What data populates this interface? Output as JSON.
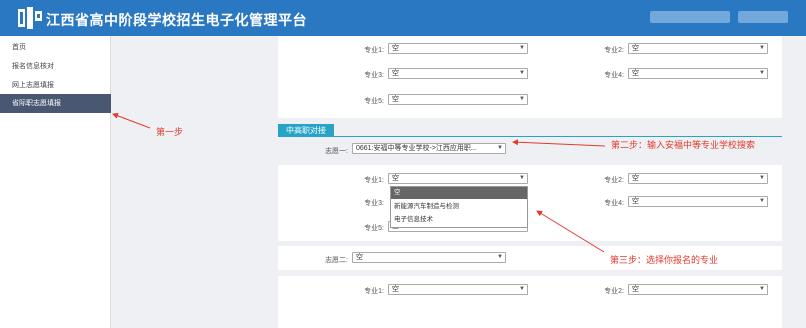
{
  "header": {
    "title": "江西省高中阶段学校招生电子化管理平台"
  },
  "sidebar": {
    "items": [
      {
        "label": "首页"
      },
      {
        "label": "报名信息核对"
      },
      {
        "label": "网上志愿填报"
      },
      {
        "label": "省际职志愿填报"
      }
    ]
  },
  "block1": {
    "rows": [
      {
        "label": "专业1:",
        "value": "空"
      },
      {
        "label": "专业2:",
        "value": "空"
      },
      {
        "label": "专业3:",
        "value": "空"
      },
      {
        "label": "专业4:",
        "value": "空"
      },
      {
        "label": "专业5:",
        "value": "空"
      }
    ]
  },
  "section": {
    "tag": "中高职对接"
  },
  "choice1": {
    "label": "志愿一:",
    "value": "0661:安福中等专业学校->江西应用职..."
  },
  "block2": {
    "rows": [
      {
        "label": "专业1:",
        "value": "空"
      },
      {
        "label": "专业2:",
        "value": "空"
      },
      {
        "label": "专业3:",
        "value": ""
      },
      {
        "label": "专业4:",
        "value": "空"
      },
      {
        "label": "专业5:",
        "value": "空"
      }
    ],
    "dropdown_options": [
      "空",
      "新能源汽车制造与检测",
      "电子信息技术"
    ]
  },
  "choice2": {
    "label": "志愿二:",
    "value": "空"
  },
  "block3": {
    "rows": [
      {
        "label": "专业1:",
        "value": "空"
      },
      {
        "label": "专业2:",
        "value": "空"
      }
    ]
  },
  "annotations": {
    "step1": "第一步",
    "step2": "第二步：输入安福中等专业学校搜索",
    "step3": "第三步：选择你报名的专业"
  },
  "colors": {
    "header": "#2a78c2",
    "active_sidebar": "#4a5773",
    "section_tag": "#26a3c7",
    "annotation": "#e23a2e"
  }
}
